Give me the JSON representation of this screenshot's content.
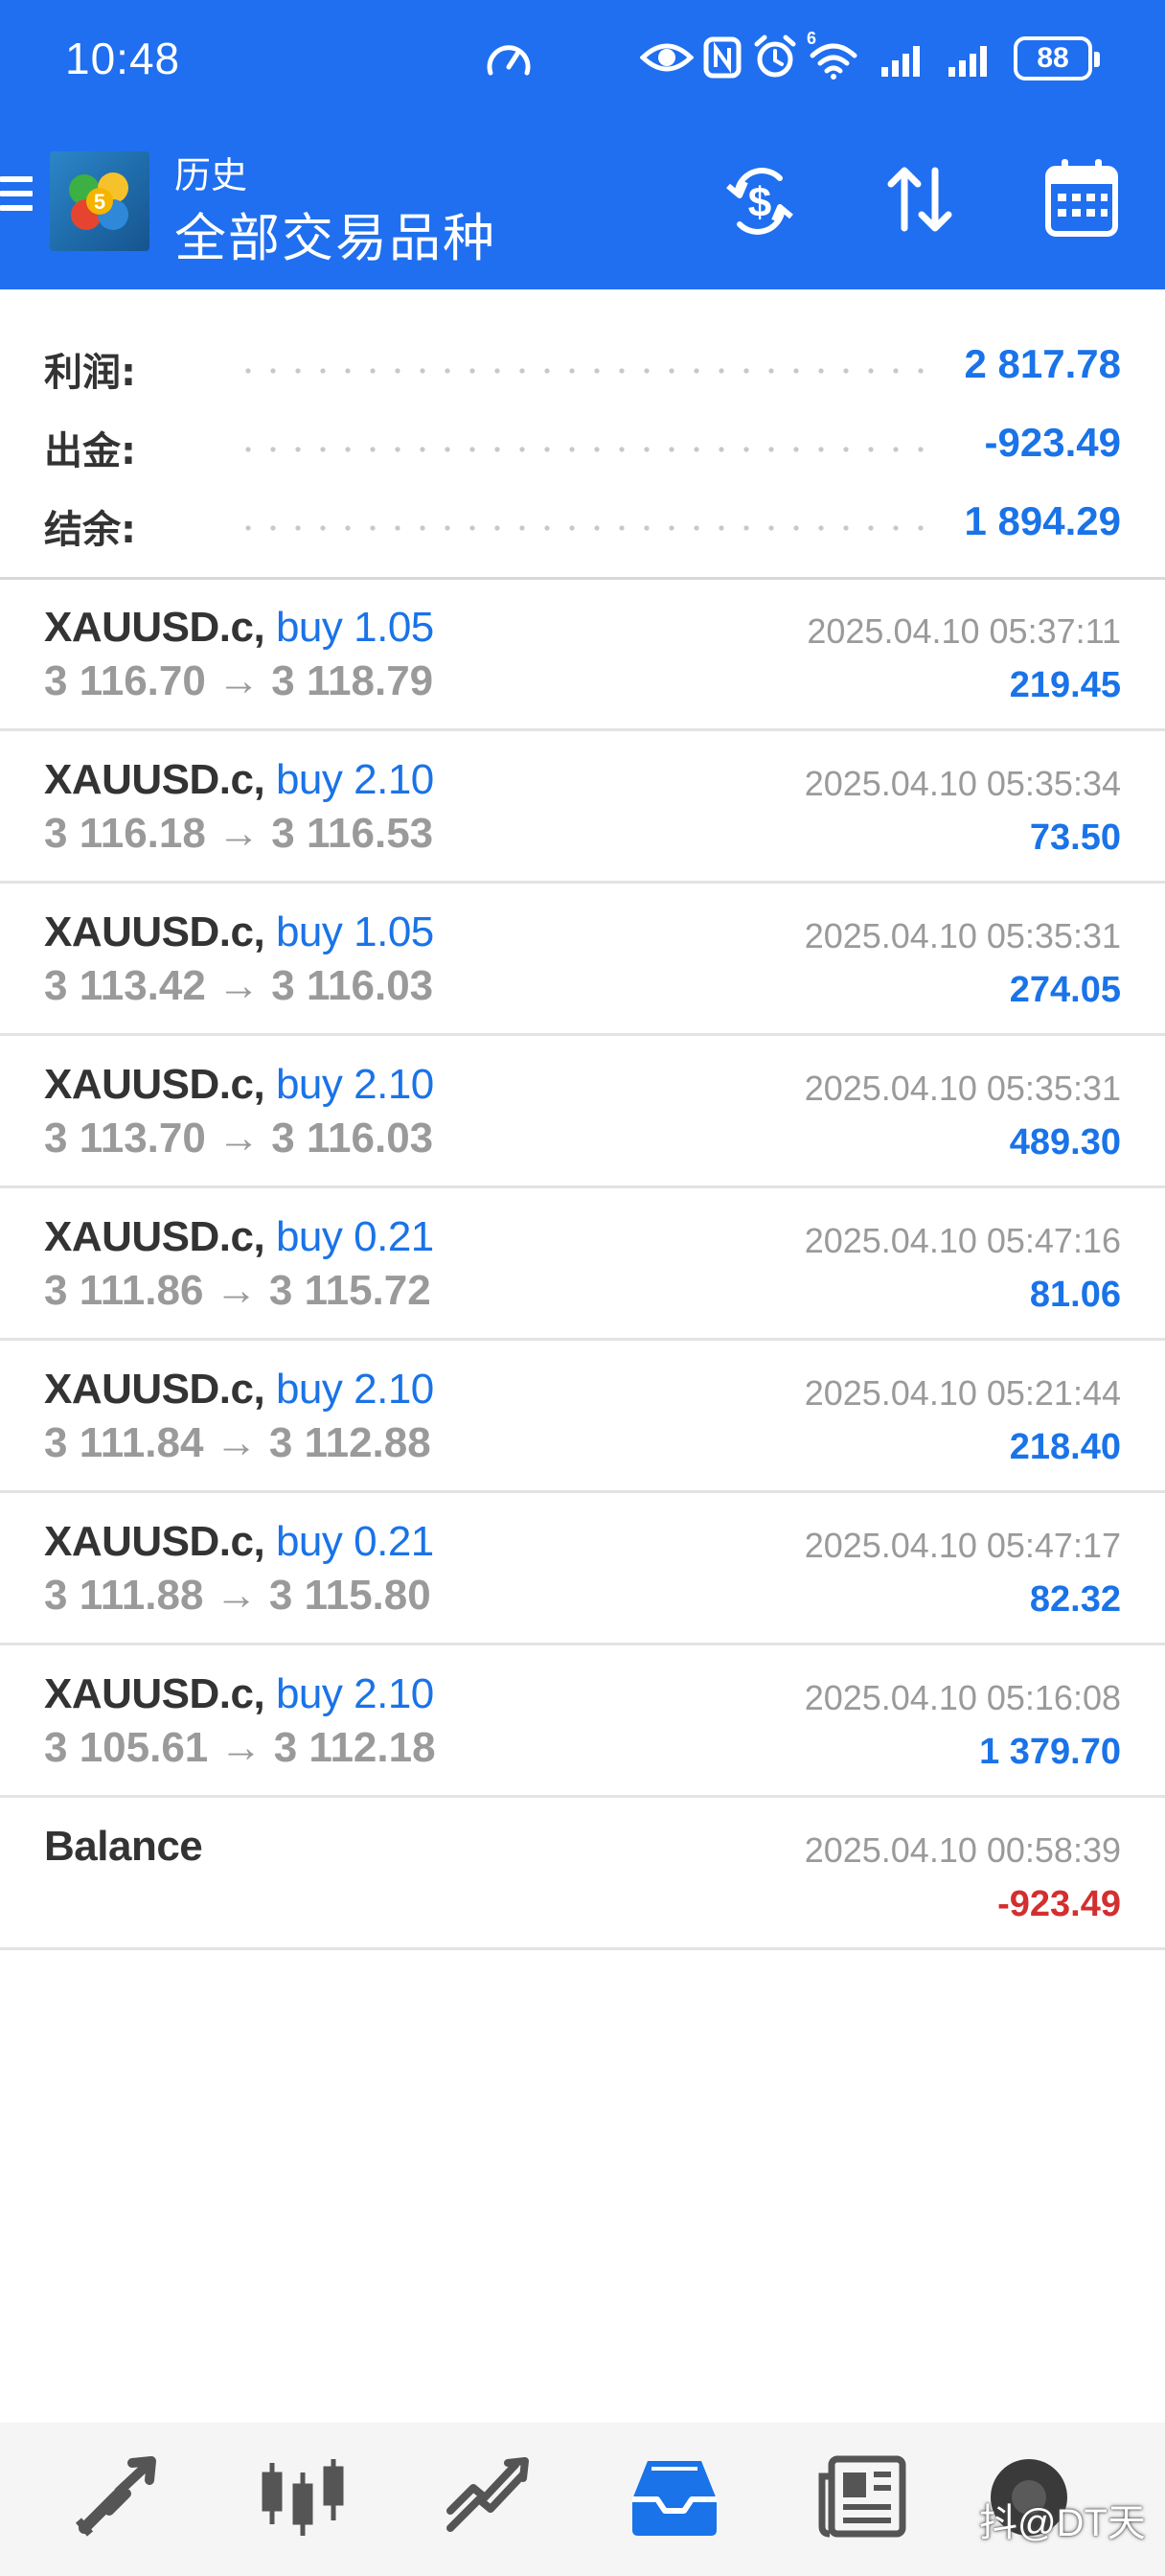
{
  "status_bar": {
    "time": "10:48",
    "network_badge": "6",
    "battery": "88"
  },
  "app_bar": {
    "title": "历史",
    "subtitle": "全部交易品种",
    "icons": [
      "menu-icon",
      "app-logo",
      "dollar-refresh-icon",
      "sort-icon",
      "calendar-icon"
    ]
  },
  "summary": {
    "profit": {
      "label": "利润:",
      "value": "2 817.78"
    },
    "withdrawal": {
      "label": "出金:",
      "value": "-923.49"
    },
    "balance": {
      "label": "结余:",
      "value": "1 894.29"
    }
  },
  "deals": [
    {
      "symbol": "XAUUSD.c,",
      "type": "buy 1.05",
      "prices": "3 116.70 → 3 118.79",
      "time": "2025.04.10 05:37:11",
      "profit": "219.45"
    },
    {
      "symbol": "XAUUSD.c,",
      "type": "buy 2.10",
      "prices": "3 116.18 → 3 116.53",
      "time": "2025.04.10 05:35:34",
      "profit": "73.50"
    },
    {
      "symbol": "XAUUSD.c,",
      "type": "buy 1.05",
      "prices": "3 113.42 → 3 116.03",
      "time": "2025.04.10 05:35:31",
      "profit": "274.05"
    },
    {
      "symbol": "XAUUSD.c,",
      "type": "buy 2.10",
      "prices": "3 113.70 → 3 116.03",
      "time": "2025.04.10 05:35:31",
      "profit": "489.30"
    },
    {
      "symbol": "XAUUSD.c,",
      "type": "buy 0.21",
      "prices": "3 111.86 → 3 115.72",
      "time": "2025.04.10 05:47:16",
      "profit": "81.06"
    },
    {
      "symbol": "XAUUSD.c,",
      "type": "buy 2.10",
      "prices": "3 111.84 → 3 112.88",
      "time": "2025.04.10 05:21:44",
      "profit": "218.40"
    },
    {
      "symbol": "XAUUSD.c,",
      "type": "buy 0.21",
      "prices": "3 111.88 → 3 115.80",
      "time": "2025.04.10 05:47:17",
      "profit": "82.32"
    },
    {
      "symbol": "XAUUSD.c,",
      "type": "buy 2.10",
      "prices": "3 105.61 → 3 112.18",
      "time": "2025.04.10 05:16:08",
      "profit": "1 379.70"
    }
  ],
  "balance_entry": {
    "label": "Balance",
    "time": "2025.04.10 00:58:39",
    "amount": "-923.49"
  },
  "bottom_nav": {
    "items": [
      "quotes-icon",
      "chart-icon",
      "trade-icon",
      "history-icon",
      "news-icon",
      "settings-icon"
    ],
    "active": "history-icon"
  },
  "watermark": "抖@DT天",
  "colors": {
    "appbar": "#1f6ff0",
    "accent": "#1a73e8",
    "negative": "#d32f2f",
    "muted": "#9a9a9a"
  }
}
